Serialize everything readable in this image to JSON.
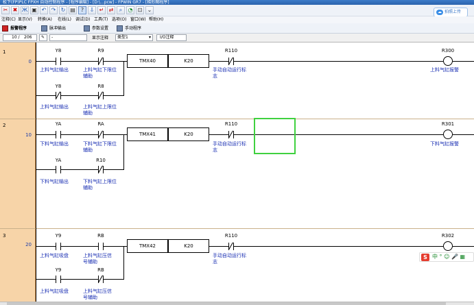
{
  "window": {
    "title": "松下(FP)PLC FPXH 自动控制程序 - [程序编辑] - [D:\\...pcw] - FPWIN GR7 - [梯形图程序]"
  },
  "cloud_button": {
    "label": "拍照上传"
  },
  "menu": {
    "items": [
      "注释(C)",
      "显示(V)",
      "转换(A)",
      "在线(L)",
      "调试(D)",
      "工具(T)",
      "选项(O)",
      "窗口(W)",
      "帮助(H)"
    ]
  },
  "program_tabs": [
    {
      "label": "报警程序",
      "active": true
    },
    {
      "label": "脉冲输出",
      "active": false
    },
    {
      "label": "参数设置",
      "active": false
    },
    {
      "label": "手动程序",
      "active": false
    }
  ],
  "status": {
    "position": "10 /",
    "total": "206",
    "mode_label": "显示注释",
    "comment_type": "类型1",
    "io_comment": "I/O注释"
  },
  "rungs": [
    {
      "number": "1",
      "step": "0",
      "row1": {
        "c1": {
          "device": "Y8",
          "comment": "上料气缸输出"
        },
        "c2": {
          "device": "R9",
          "comment": "上料气缸下限位\n辅助"
        },
        "timer": "TMX40",
        "preset": "K20",
        "c3": {
          "device": "R110",
          "comment": "手动自动运行标\n志"
        },
        "coil": {
          "device": "R300",
          "comment": "上料气缸报警"
        }
      },
      "row2": {
        "c1": {
          "device": "Y8",
          "comment": "上料气缸输出"
        },
        "c2": {
          "device": "R8",
          "comment": "上料气缸上限位\n辅助"
        }
      }
    },
    {
      "number": "2",
      "step": "10",
      "row1": {
        "c1": {
          "device": "YA",
          "comment": "下料气缸输出"
        },
        "c2": {
          "device": "RA",
          "comment": "下料气缸下限位\n辅助"
        },
        "timer": "TMX41",
        "preset": "K20",
        "c3": {
          "device": "R110",
          "comment": "手动自动运行标\n志"
        },
        "coil": {
          "device": "R301",
          "comment": "下料气缸报警"
        }
      },
      "row2": {
        "c1": {
          "device": "YA",
          "comment": "下料气缸输出"
        },
        "c2": {
          "device": "R10",
          "comment": "下料气缸上限位\n辅助"
        }
      }
    },
    {
      "number": "3",
      "step": "20",
      "row1": {
        "c1": {
          "device": "Y9",
          "comment": "上料气缸吸盘"
        },
        "c2": {
          "device": "RB",
          "comment": "上料气缸压信\n号辅助"
        },
        "timer": "TMX42",
        "preset": "K20",
        "c3": {
          "device": "R110",
          "comment": "手动自动运行标\n志"
        },
        "coil": {
          "device": "R302",
          "comment": ""
        }
      },
      "row2": {
        "c1": {
          "device": "Y9",
          "comment": "上料气缸吸盘"
        },
        "c2": {
          "device": "RB",
          "comment": "上料气缸压信\n号辅助"
        }
      }
    }
  ],
  "ime": {
    "s": "S",
    "text": "中 ° ☺ 🎤 ▦"
  }
}
